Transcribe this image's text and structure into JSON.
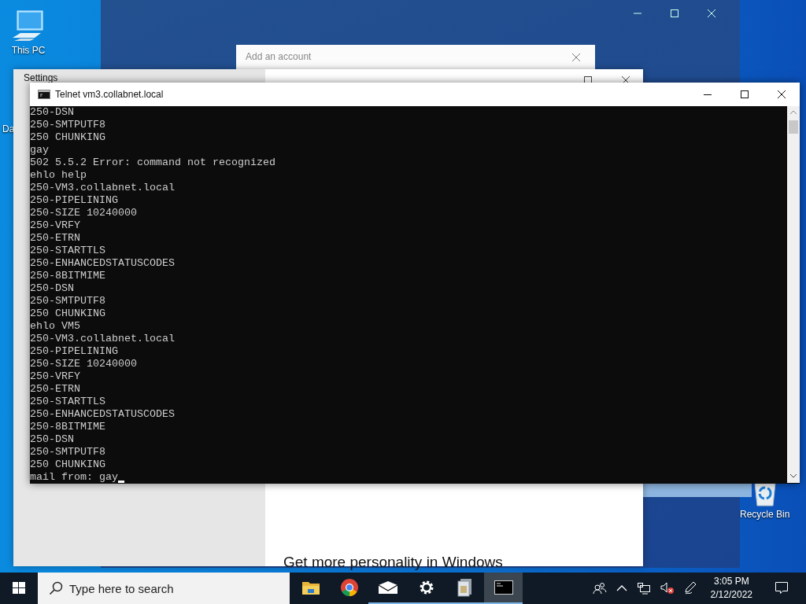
{
  "desktop_icons": [
    {
      "kind": "computer",
      "label": "This PC"
    },
    {
      "kind": "partial",
      "label": "Da"
    },
    {
      "kind": "recycle",
      "label": "Recycle Bin"
    }
  ],
  "account_dialog": {
    "title": "Add an account"
  },
  "settings_window": {
    "title": "Settings",
    "heading": "Get more personality in Windows"
  },
  "terminal": {
    "title": "Telnet vm3.collabnet.local",
    "lines": [
      "250-DSN",
      "250-SMTPUTF8",
      "250 CHUNKING",
      "gay",
      "502 5.5.2 Error: command not recognized",
      "ehlo help",
      "250-VM3.collabnet.local",
      "250-PIPELINING",
      "250-SIZE 10240000",
      "250-VRFY",
      "250-ETRN",
      "250-STARTTLS",
      "250-ENHANCEDSTATUSCODES",
      "250-8BITMIME",
      "250-DSN",
      "250-SMTPUTF8",
      "250 CHUNKING",
      "ehlo VM5",
      "250-VM3.collabnet.local",
      "250-PIPELINING",
      "250-SIZE 10240000",
      "250-VRFY",
      "250-ETRN",
      "250-STARTTLS",
      "250-ENHANCEDSTATUSCODES",
      "250-8BITMIME",
      "250-DSN",
      "250-SMTPUTF8",
      "250 CHUNKING",
      "mail from: gay"
    ]
  },
  "taskbar": {
    "search": {
      "placeholder": "Type here to search"
    },
    "apps": [
      {
        "kind": "folder",
        "running": false,
        "selected": false
      },
      {
        "kind": "browser",
        "running": false,
        "selected": false
      },
      {
        "kind": "mail",
        "running": true,
        "selected": false
      },
      {
        "kind": "settings",
        "running": true,
        "selected": false
      },
      {
        "kind": "document",
        "running": true,
        "selected": false
      },
      {
        "kind": "terminal",
        "running": true,
        "selected": true
      }
    ],
    "time": "3:05 PM",
    "date": "2/12/2022"
  }
}
